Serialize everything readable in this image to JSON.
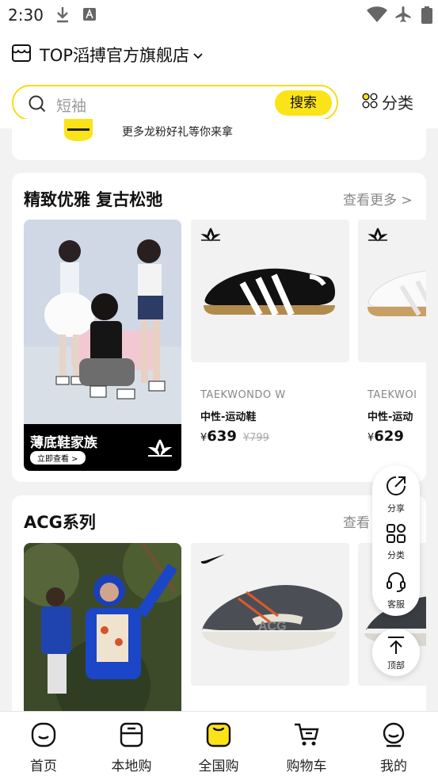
{
  "status_bar": {
    "time": "2:30"
  },
  "header": {
    "store_name": "TOP滔搏官方旗舰店",
    "search_placeholder": "短袖",
    "search_button": "搜索",
    "category_label": "分类"
  },
  "peek_banner": {
    "text": "更多龙粉好礼等你来拿"
  },
  "sections": [
    {
      "title": "精致优雅 复古松弛",
      "more_label": "查看更多 >",
      "promo": {
        "title": "薄底鞋家族",
        "cta": "立即查看 >"
      },
      "products": [
        {
          "name": "TAEKWONDO W",
          "type": "中性-运动鞋",
          "currency": "¥",
          "price": "639",
          "old_price": "¥799"
        },
        {
          "name": "TAEKWOI",
          "type": "中性-运动",
          "currency": "¥",
          "price": "629"
        }
      ]
    },
    {
      "title": "ACG系列",
      "more_label": "查看"
    }
  ],
  "float_menu": {
    "share": "分享",
    "category": "分类",
    "service": "客服",
    "top": "顶部"
  },
  "tabbar": [
    {
      "label": "首页"
    },
    {
      "label": "本地购"
    },
    {
      "label": "全国购"
    },
    {
      "label": "购物车"
    },
    {
      "label": "我的"
    }
  ],
  "colors": {
    "accent": "#fbe319",
    "search_border": "#f7dc1b",
    "text": "#111111",
    "muted": "#888888"
  },
  "icons": [
    "download-icon",
    "font-icon",
    "wifi-icon",
    "airplane-icon",
    "battery-icon",
    "store-icon",
    "chevron-down-icon",
    "search-icon",
    "category-icon",
    "adidas-logo",
    "nike-logo",
    "share-icon",
    "service-icon",
    "arrow-up-icon",
    "home-icon",
    "local-icon",
    "national-icon",
    "cart-icon",
    "profile-icon"
  ]
}
